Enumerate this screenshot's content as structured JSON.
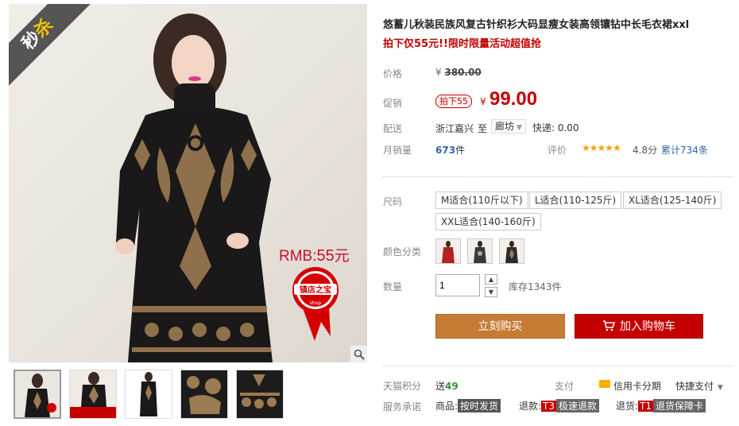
{
  "gallery": {
    "ribbon_text": "秒杀",
    "price_overlay": "RMB:55元",
    "seal_text": "镇店之宝",
    "seal_sub": "shop",
    "zoom_icon": "magnifier-icon",
    "thumb_count": 5
  },
  "product": {
    "title": "悠蓄儿秋装民族风复古针织衫大码显瘦女装高领镶钻中长毛衣裙xxl",
    "subtitle": "拍下仅55元!!限时限量活动超值抢"
  },
  "price": {
    "label": "价格",
    "currency": "¥",
    "original": "380.00",
    "promo_label": "促销",
    "promo_tag": "拍下55",
    "current": "99.00"
  },
  "shipping": {
    "label": "配送",
    "from": "浙江嘉兴",
    "to_word": "至",
    "destination": "廊坊",
    "express": "快递: 0.00"
  },
  "sales": {
    "label": "月销量",
    "count": "673",
    "unit": "件",
    "rating_label": "评价",
    "stars": "★★★★★",
    "score": "4.8分",
    "review_count": "累计734条"
  },
  "options": {
    "size_label": "尺码",
    "sizes": [
      "M适合(110斤以下)",
      "L适合(110-125斤)",
      "XL适合(125-140斤)",
      "XXL适合(140-160斤)"
    ],
    "color_label": "颜色分类",
    "colors": [
      "#b22222",
      "#3a3a3a",
      "#2a2a2a"
    ],
    "qty_label": "数量",
    "qty_value": "1",
    "stock": "库存1343件"
  },
  "actions": {
    "buy_now": "立刻购买",
    "add_to_cart": "加入购物车",
    "cart_icon": "cart-icon"
  },
  "footer": {
    "points_label": "天猫积分",
    "points_prefix": "送",
    "points_value": "49",
    "pay_label": "支付",
    "credit_card": "信用卡分期",
    "quick_pay": "快捷支付",
    "promise_label": "服务承诺",
    "promise_goods": "商品:",
    "promise_goods_tag": "按时发货",
    "promise_refund": "退款:",
    "promise_refund_tag": "T3",
    "promise_refund_text": "极速退款",
    "promise_return": "退货:",
    "promise_return_tag": "T1",
    "promise_return_text": "退货保障卡"
  }
}
